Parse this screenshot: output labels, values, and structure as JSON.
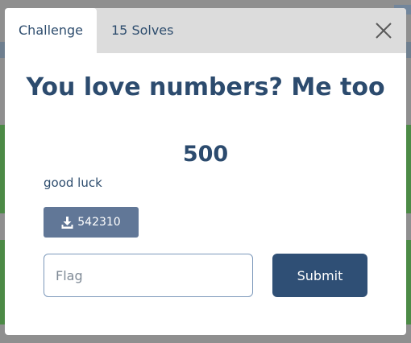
{
  "tabs": {
    "challenge_label": "Challenge",
    "solves_label": "15 Solves"
  },
  "challenge": {
    "title": "You love numbers? Me too",
    "points": "500",
    "description": "good luck",
    "file_label": "542310"
  },
  "flag": {
    "placeholder": "Flag",
    "value": ""
  },
  "submit_label": "Submit",
  "icons": {
    "close": "close-icon",
    "download": "download-icon"
  },
  "colors": {
    "accent": "#2f4f75",
    "title": "#2c4b6e",
    "download_button": "#617797",
    "tab_bar": "#dcdcdc",
    "backdrop_card": "#4c8a46"
  }
}
